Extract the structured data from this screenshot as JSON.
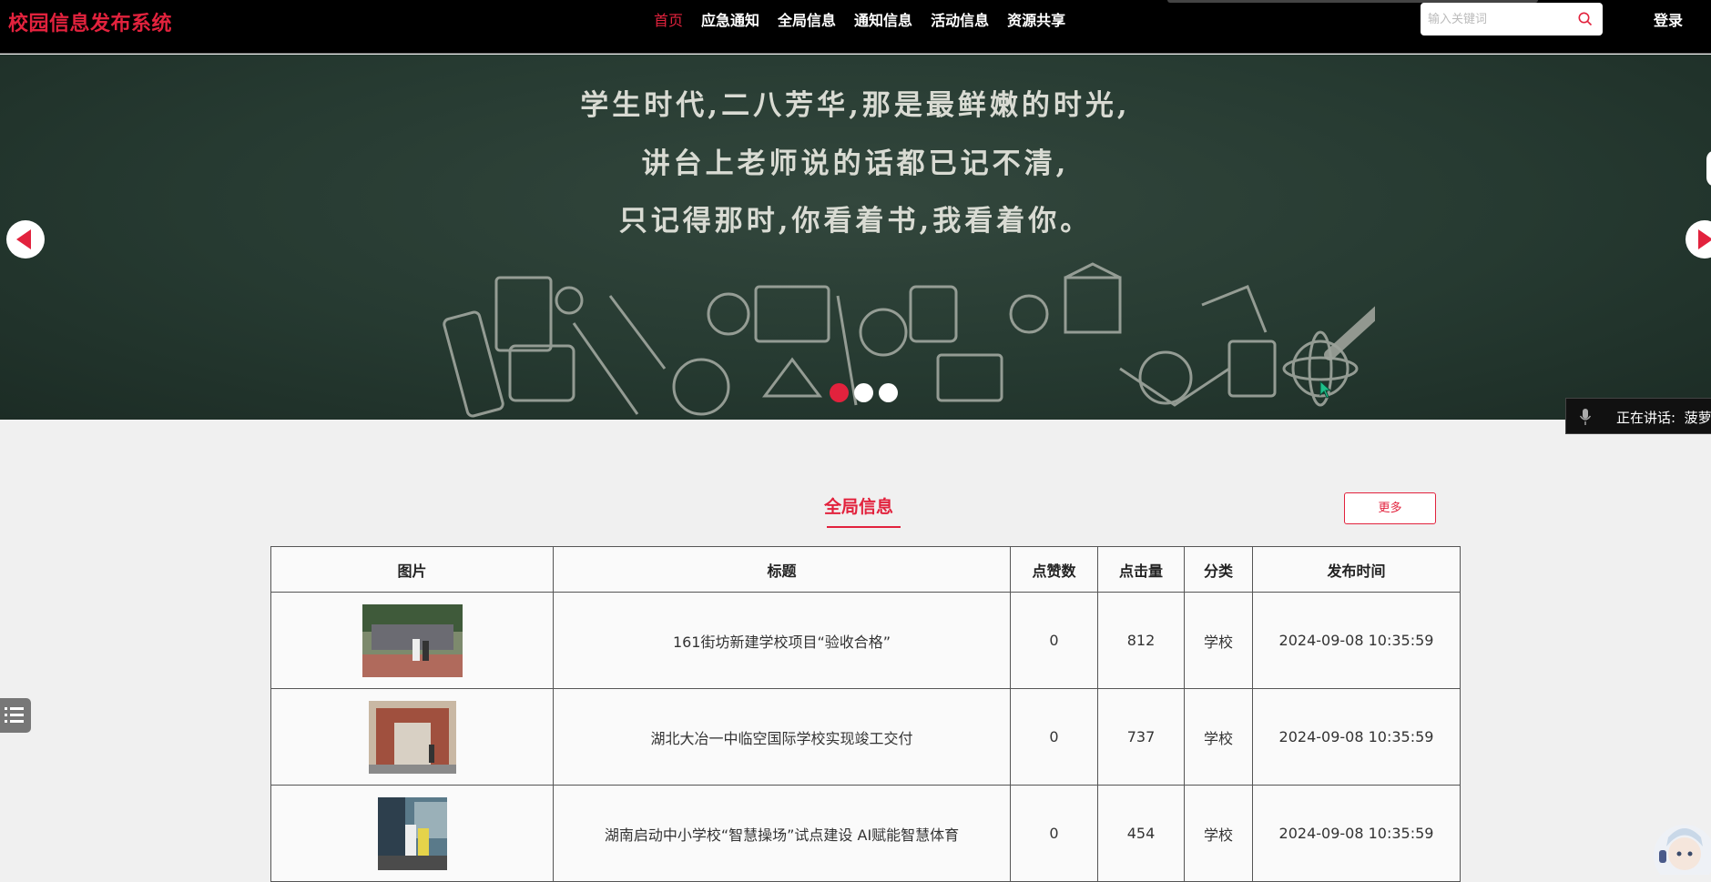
{
  "header": {
    "brand": "校园信息发布系统",
    "nav": [
      "首页",
      "应急通知",
      "全局信息",
      "通知信息",
      "活动信息",
      "资源共享"
    ],
    "active_nav": "首页",
    "search_placeholder": "输入关键词",
    "login": "登录"
  },
  "banner": {
    "lines": [
      "学生时代,二八芳华,那是最鲜嫩的时光,",
      "讲台上老师说的话都已记不清,",
      "只记得那时,你看着书,我看着你。"
    ],
    "slide_count": 3,
    "active_slide": 1
  },
  "speaking": {
    "label": "正在讲话:",
    "name": "菠萝"
  },
  "section": {
    "title": "全局信息",
    "more": "更多",
    "columns": [
      "图片",
      "标题",
      "点赞数",
      "点击量",
      "分类",
      "发布时间"
    ],
    "rows": [
      {
        "title": "161街坊新建学校项目“验收合格”",
        "likes": "0",
        "clicks": "812",
        "category": "学校",
        "time": "2024-09-08 10:35:59"
      },
      {
        "title": "湖北大冶一中临空国际学校实现竣工交付",
        "likes": "0",
        "clicks": "737",
        "category": "学校",
        "time": "2024-09-08 10:35:59"
      },
      {
        "title": "湖南启动中小学校“智慧操场”试点建设 AI赋能智慧体育",
        "likes": "0",
        "clicks": "454",
        "category": "学校",
        "time": "2024-09-08 10:35:59"
      }
    ]
  },
  "colors": {
    "accent": "#e2223d",
    "header_bg": "#000000",
    "banner_bg": "#263a31"
  }
}
